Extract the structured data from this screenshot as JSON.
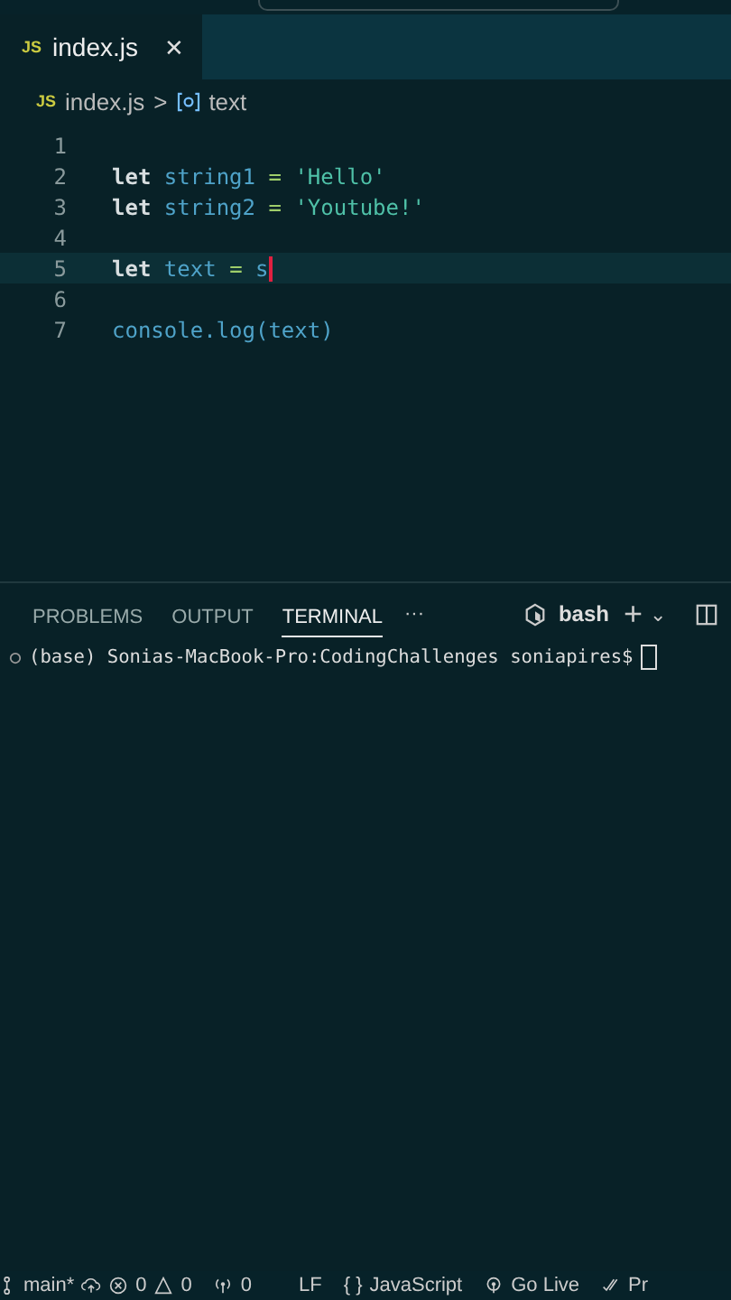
{
  "tabs": [
    {
      "icon": "JS",
      "label": "index.js",
      "close": "✕",
      "selected": true
    }
  ],
  "breadcrumb": {
    "icon": "JS",
    "file": "index.js",
    "separator": ">",
    "symbol": "text"
  },
  "editor": {
    "lines": [
      {
        "number": "1",
        "current": false
      },
      {
        "number": "2",
        "current": false,
        "tokens": [
          {
            "kind": "keyword",
            "text": "let"
          },
          {
            "kind": "variable",
            "text": "string1"
          },
          {
            "kind": "operator",
            "text": "="
          },
          {
            "kind": "string",
            "text": "'Hello'"
          }
        ]
      },
      {
        "number": "3",
        "current": false,
        "tokens": [
          {
            "kind": "keyword",
            "text": "let"
          },
          {
            "kind": "variable",
            "text": "string2"
          },
          {
            "kind": "operator",
            "text": "="
          },
          {
            "kind": "string",
            "text": "'Youtube!'"
          }
        ]
      },
      {
        "number": "4",
        "current": false
      },
      {
        "number": "5",
        "current": true,
        "tokens": [
          {
            "kind": "keyword",
            "text": "let"
          },
          {
            "kind": "variable",
            "text": "text"
          },
          {
            "kind": "operator",
            "text": "="
          },
          {
            "kind": "plain",
            "text": "s"
          }
        ]
      },
      {
        "number": "6",
        "current": false
      },
      {
        "number": "7",
        "current": false,
        "tokens": [
          {
            "kind": "call",
            "text": "console.log(text)"
          }
        ]
      }
    ]
  },
  "panel": {
    "tabs": [
      {
        "label": "PROBLEMS",
        "selected": false
      },
      {
        "label": "OUTPUT",
        "selected": false
      },
      {
        "label": "TERMINAL",
        "selected": true
      }
    ],
    "more": "···",
    "shell": "bash",
    "add": "+",
    "caret": "⌄"
  },
  "terminal": {
    "prompt": "(base) Sonias-MacBook-Pro:CodingChallenges soniapires$"
  },
  "status_bar": {
    "branch": "main*",
    "errors": "0",
    "warnings": "0",
    "ports": "0",
    "eol": "LF",
    "language_icon": "{ }",
    "language": "JavaScript",
    "go_live": "Go Live",
    "prettier": "Pr"
  }
}
